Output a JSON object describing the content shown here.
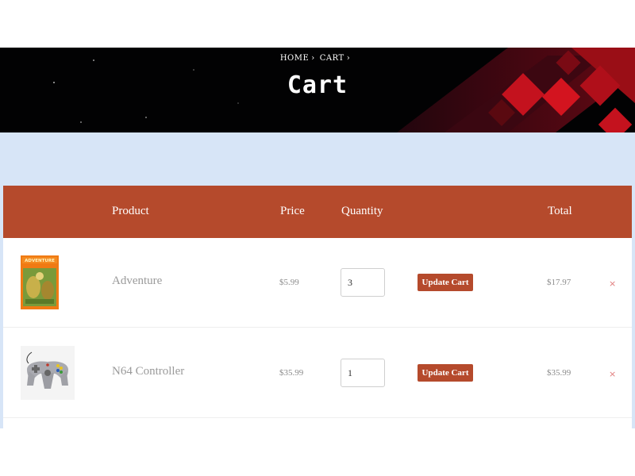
{
  "breadcrumb": {
    "home": "HOME",
    "cart": "CART",
    "sep_icon": "chevron-right-icon"
  },
  "page": {
    "title": "Cart"
  },
  "table": {
    "headers": {
      "product": "Product",
      "price": "Price",
      "quantity": "Quantity",
      "total": "Total"
    },
    "update_label": "Update Cart",
    "remove_glyph": "×",
    "items": [
      {
        "name": "Adventure",
        "price": "$5.99",
        "quantity": "3",
        "total": "$17.97",
        "thumb": "adventure-game-box-art"
      },
      {
        "name": "N64 Controller",
        "price": "$35.99",
        "quantity": "1",
        "total": "$35.99",
        "thumb": "n64-controller-image"
      }
    ]
  },
  "colors": {
    "accent": "#b54a2c",
    "band": "#d7e5f7",
    "hero_bg": "#020203"
  }
}
